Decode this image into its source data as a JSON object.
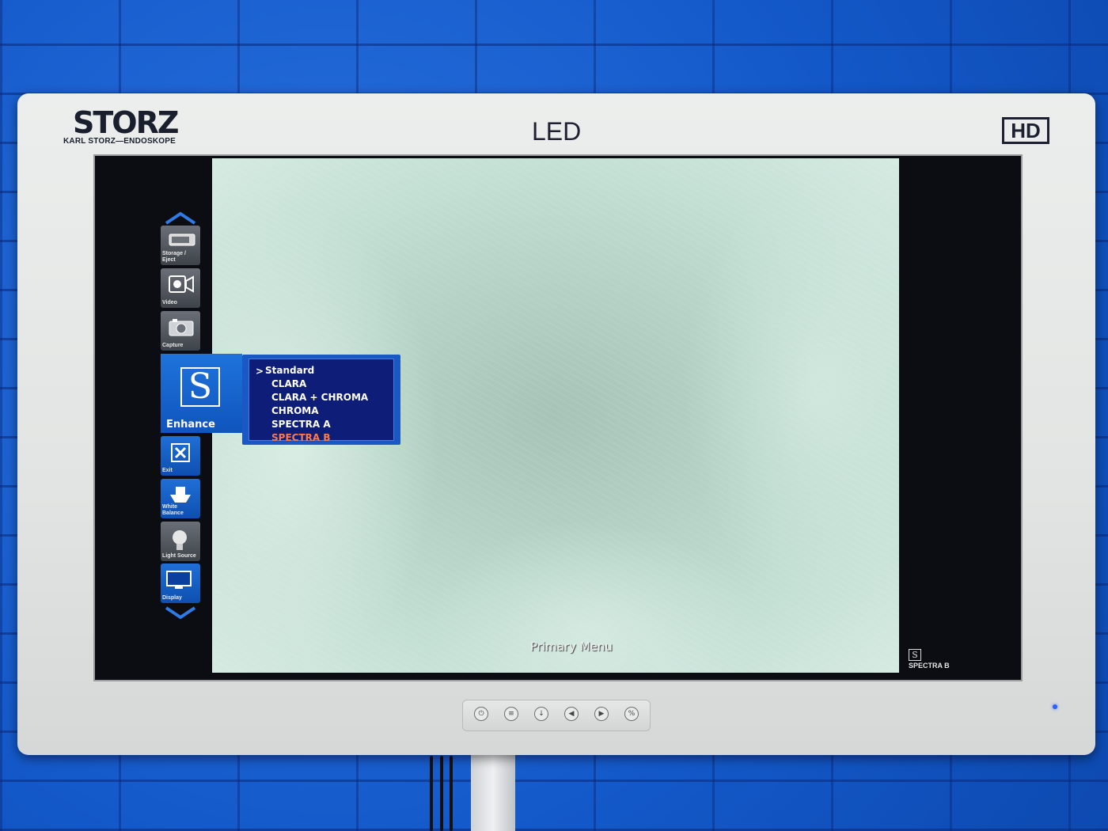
{
  "monitor": {
    "brand_logo": "STORZ",
    "brand_tagline": "KARL STORZ—ENDOSKOPE",
    "panel_type": "LED",
    "resolution_badge": "HD"
  },
  "side_menu": {
    "items": [
      {
        "label": "Storage / Eject",
        "icon": "storage-eject-icon"
      },
      {
        "label": "Video",
        "icon": "video-camera-icon"
      },
      {
        "label": "Capture",
        "icon": "camera-icon"
      },
      {
        "label": "Enhance",
        "icon": "enhance-s-icon",
        "glyph": "S",
        "selected": true
      },
      {
        "label": "Exit",
        "icon": "exit-x-icon",
        "glyph": "X"
      },
      {
        "label": "White Balance",
        "icon": "white-balance-icon"
      },
      {
        "label": "Light Source",
        "icon": "light-source-icon"
      },
      {
        "label": "Display",
        "icon": "display-monitor-icon"
      }
    ]
  },
  "enhance_menu": {
    "caret": ">",
    "options": [
      "Standard",
      "CLARA",
      "CLARA + CHROMA",
      "CHROMA",
      "SPECTRA A",
      "SPECTRA B"
    ],
    "highlighted": "SPECTRA B",
    "cursor_on": "Standard"
  },
  "overlay": {
    "menu_title": "Primary Menu",
    "mode_glyph": "S",
    "mode_status": "SPECTRA B"
  },
  "colors": {
    "menu_blue": "#1a59c4",
    "submenu_bg": "#0d1d78",
    "highlight_text": "#ff7a4a",
    "power_led": "#2d5cff"
  }
}
